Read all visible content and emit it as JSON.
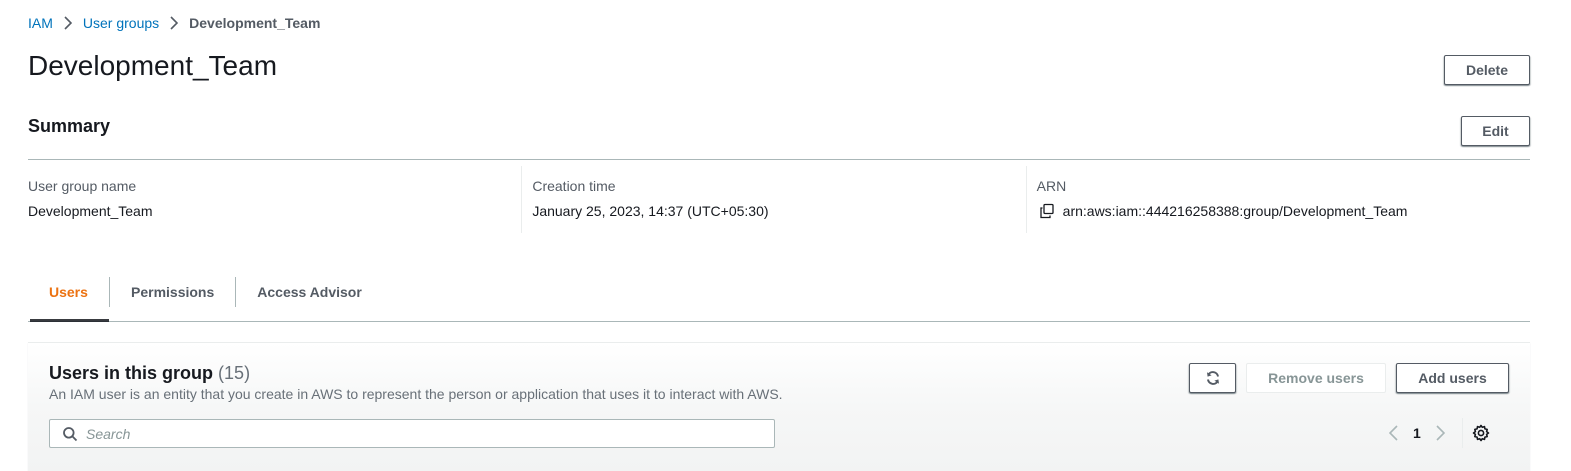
{
  "breadcrumb": {
    "items": [
      {
        "label": "IAM"
      },
      {
        "label": "User groups"
      }
    ],
    "current": "Development_Team"
  },
  "header": {
    "title": "Development_Team",
    "delete_label": "Delete"
  },
  "summary": {
    "title": "Summary",
    "edit_label": "Edit",
    "fields": [
      {
        "label": "User group name",
        "value": "Development_Team"
      },
      {
        "label": "Creation time",
        "value": "January 25, 2023, 14:37 (UTC+05:30)"
      },
      {
        "label": "ARN",
        "value": "arn:aws:iam::444216258388:group/Development_Team",
        "icon": "copy-icon"
      }
    ]
  },
  "tabs": [
    {
      "label": "Users",
      "active": true
    },
    {
      "label": "Permissions",
      "active": false
    },
    {
      "label": "Access Advisor",
      "active": false
    }
  ],
  "users_panel": {
    "title": "Users in this group",
    "count": "(15)",
    "description": "An IAM user is an entity that you create in AWS to represent the person or application that uses it to interact with AWS.",
    "refresh_icon": "refresh-icon",
    "remove_label": "Remove users",
    "add_label": "Add users",
    "search": {
      "placeholder": "Search",
      "value": ""
    },
    "pagination": {
      "current_page": "1"
    }
  },
  "colors": {
    "link": "#0073bb",
    "active_tab": "#ec7211",
    "text_primary": "#16191f",
    "text_secondary": "#545b64",
    "border": "#aab7b8"
  }
}
